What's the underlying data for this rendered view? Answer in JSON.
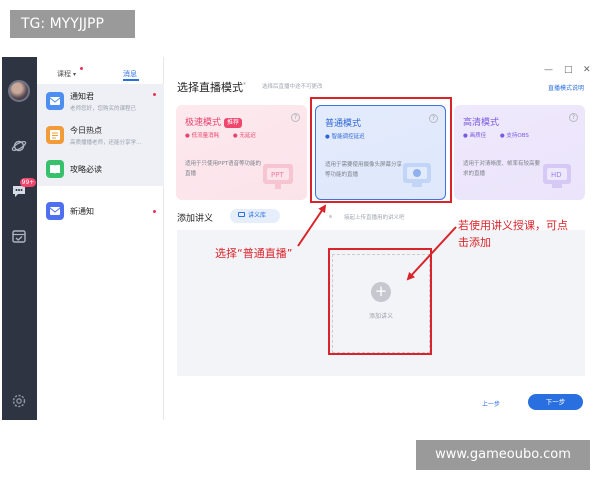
{
  "watermarks": {
    "top": "TG: MYYJJPP",
    "bottom": "www.gameoubo.com"
  },
  "colors": {
    "accent": "#2a6fe0",
    "annotation": "#d8242a",
    "rail": "#2e3442",
    "badge": "#f0466e"
  },
  "rail": {
    "items": [
      {
        "name": "avatar"
      },
      {
        "name": "planet-icon"
      },
      {
        "name": "chat-bubble-icon",
        "badge": "99+"
      },
      {
        "name": "calendar-check-icon"
      },
      {
        "name": "gear-icon"
      }
    ]
  },
  "message_panel": {
    "tab_course": "课程",
    "tab_messages": "消息",
    "items": [
      {
        "title": "通知君",
        "subtitle": "老师您好，您购买的课程已",
        "icon_color": "#4d8ef0",
        "unread": true
      },
      {
        "title": "今日热点",
        "subtitle": "高质播播老师，还能分享学…",
        "icon_color": "#f29b38",
        "unread": false
      },
      {
        "title": "攻略必读",
        "subtitle": "",
        "icon_color": "#39c06a",
        "unread": false
      },
      {
        "title": "新通知",
        "subtitle": "",
        "icon_color": "#4d6ff0",
        "unread": true
      }
    ]
  },
  "window_controls": {
    "minimize": "—",
    "maximize": "□",
    "close": "✕"
  },
  "main": {
    "title": "选择直播模式",
    "title_mark": "*",
    "hint": "选择后直播中途不可更改",
    "mode_help": "直播模式说明",
    "modes": [
      {
        "title": "极速模式",
        "tag": "推荐",
        "features": [
          "低流量消耗",
          "无延迟"
        ],
        "description": "适用于只使用PPT语音等功能的直播",
        "selected": false
      },
      {
        "title": "普通模式",
        "tag": "",
        "features": [
          "智能调控延迟"
        ],
        "description": "适用于需要使用摄像头屏幕分享等功能的直播",
        "selected": true
      },
      {
        "title": "高清模式",
        "tag": "",
        "features": [
          "画质佳",
          "支持OBS"
        ],
        "description": "适用于对清晰度、帧率有较高要求的直播",
        "selected": false
      }
    ],
    "handout": {
      "label": "添加讲义",
      "library_button": "讲义库",
      "upload_hint": "接起上传直播用的讲义吧",
      "add_label": "添加讲义"
    },
    "prev_button": "上一步",
    "next_button": "下一步"
  },
  "annotations": {
    "select_mode": "选择“普通直播”",
    "add_handout_line1": "若使用讲义授课，可点",
    "add_handout_line2": "击添加"
  }
}
